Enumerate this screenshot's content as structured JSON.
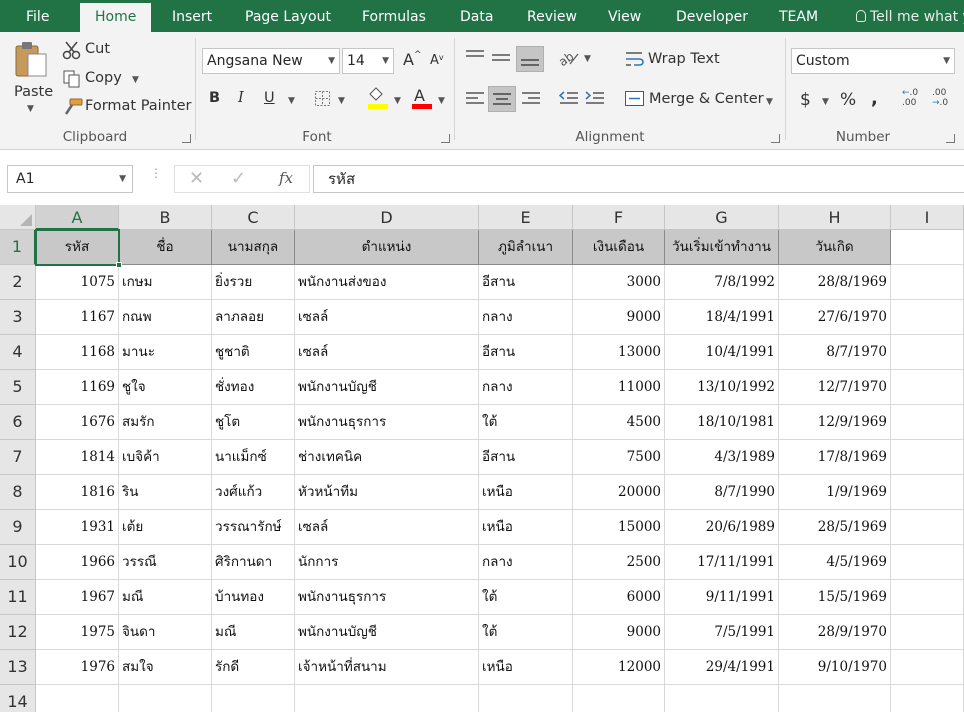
{
  "ribbon_tabs": [
    "File",
    "Home",
    "Insert",
    "Page Layout",
    "Formulas",
    "Data",
    "Review",
    "View",
    "Developer",
    "TEAM"
  ],
  "tell_me": "Tell me what y",
  "clipboard": {
    "paste": "Paste",
    "cut": "Cut",
    "copy": "Copy",
    "format_painter": "Format Painter",
    "group_label": "Clipboard"
  },
  "font": {
    "name": "Angsana New",
    "size": "14",
    "group_label": "Font",
    "bold": "B",
    "italic": "I",
    "underline": "U",
    "grow": "A",
    "shrink": "A",
    "highlight_color": "#ffff00",
    "font_color": "#ff0000"
  },
  "alignment": {
    "wrap_text": "Wrap Text",
    "merge_center": "Merge & Center",
    "group_label": "Alignment"
  },
  "number": {
    "format": "Custom",
    "currency": "$",
    "percent": "%",
    "comma": ",",
    "inc_decimal": "←.0\n.00",
    "group_label": "Number"
  },
  "formula_bar": {
    "name_box": "A1",
    "fx": "fx",
    "content": "รหัส"
  },
  "columns": [
    "A",
    "B",
    "C",
    "D",
    "E",
    "F",
    "G",
    "H",
    "I"
  ],
  "rows": [
    "1",
    "2",
    "3",
    "4",
    "5",
    "6",
    "7",
    "8",
    "9",
    "10",
    "11",
    "12",
    "13",
    "14"
  ],
  "header_row": [
    "รหัส",
    "ชื่อ",
    "นามสกุล",
    "ตำแหน่ง",
    "ภูมิลำเนา",
    "เงินเดือน",
    "วันเริ่มเข้าทำงาน",
    "วันเกิด"
  ],
  "data_rows": [
    [
      "1075",
      "เกษม",
      "ยิ่งรวย",
      "พนักงานส่งของ",
      "อีสาน",
      "3000",
      "7/8/1992",
      "28/8/1969"
    ],
    [
      "1167",
      "กณพ",
      "ลาภลอย",
      "เซลล์",
      "กลาง",
      "9000",
      "18/4/1991",
      "27/6/1970"
    ],
    [
      "1168",
      "มานะ",
      "ชูชาติ",
      "เซลล์",
      "อีสาน",
      "13000",
      "10/4/1991",
      "8/7/1970"
    ],
    [
      "1169",
      "ชูใจ",
      "ชั่งทอง",
      "พนักงานบัญชี",
      "กลาง",
      "11000",
      "13/10/1992",
      "12/7/1970"
    ],
    [
      "1676",
      "สมรัก",
      "ชูโต",
      "พนักงานธุรการ",
      "ใต้",
      "4500",
      "18/10/1981",
      "12/9/1969"
    ],
    [
      "1814",
      "เบจิค้า",
      "นาแม็กซ์",
      "ช่างเทคนิค",
      "อีสาน",
      "7500",
      "4/3/1989",
      "17/8/1969"
    ],
    [
      "1816",
      "ริน",
      "วงศ์แก้ว",
      "หัวหน้าทีม",
      "เหนือ",
      "20000",
      "8/7/1990",
      "1/9/1969"
    ],
    [
      "1931",
      "เต้ย",
      "วรรณารักษ์",
      "เซลล์",
      "เหนือ",
      "15000",
      "20/6/1989",
      "28/5/1969"
    ],
    [
      "1966",
      "วรรณี",
      "ศิริกานดา",
      "นักการ",
      "กลาง",
      "2500",
      "17/11/1991",
      "4/5/1969"
    ],
    [
      "1967",
      "มณี",
      "บ้านทอง",
      "พนักงานธุรการ",
      "ใต้",
      "6000",
      "9/11/1991",
      "15/5/1969"
    ],
    [
      "1975",
      "จินดา",
      "มณี",
      "พนักงานบัญชี",
      "ใต้",
      "9000",
      "7/5/1991",
      "28/9/1970"
    ],
    [
      "1976",
      "สมใจ",
      "รักดี",
      "เจ้าหน้าที่สนาม",
      "เหนือ",
      "12000",
      "29/4/1991",
      "9/10/1970"
    ]
  ],
  "colors": {
    "excel_green": "#217346",
    "header_fill": "#c8c8c8"
  }
}
